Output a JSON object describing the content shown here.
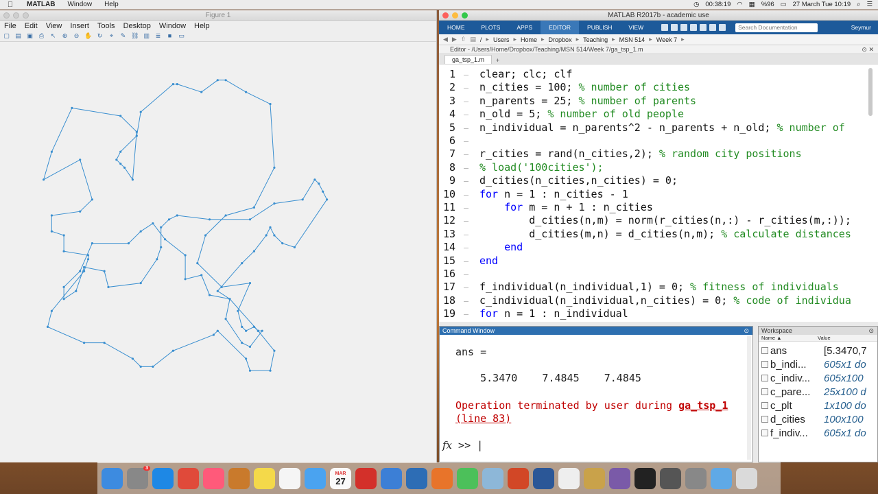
{
  "menubar": {
    "app": "MATLAB",
    "items": [
      "Window",
      "Help"
    ],
    "clock": "00:38:19",
    "battery": "%96",
    "date": "27 March Tue  10:19"
  },
  "figure": {
    "title": "Figure 1",
    "menu": [
      "File",
      "Edit",
      "View",
      "Insert",
      "Tools",
      "Desktop",
      "Window",
      "Help"
    ]
  },
  "matlab": {
    "title": "MATLAB R2017b - academic use",
    "tabs": [
      "HOME",
      "PLOTS",
      "APPS",
      "EDITOR",
      "PUBLISH",
      "VIEW"
    ],
    "active_tab": "EDITOR",
    "search_placeholder": "Search Documentation",
    "user": "Seymur",
    "path": [
      "/",
      "Users",
      "Home",
      "Dropbox",
      "Teaching",
      "MSN 514",
      "Week 7"
    ],
    "editor_header": "Editor - /Users/Home/Dropbox/Teaching/MSN 514/Week 7/ga_tsp_1.m",
    "file_tab": "ga_tsp_1.m"
  },
  "code": {
    "line_numbers": [
      "1",
      "2",
      "3",
      "4",
      "5",
      "6",
      "7",
      "8",
      "9",
      "10",
      "11",
      "12",
      "13",
      "14",
      "15",
      "16",
      "17",
      "18",
      "19"
    ],
    "lines": [
      {
        "pre": "clear; clc; clf",
        "comment": ""
      },
      {
        "pre": "n_cities = 100; ",
        "comment": "% number of cities"
      },
      {
        "pre": "n_parents = 25; ",
        "comment": "% number of parents"
      },
      {
        "pre": "n_old = 5; ",
        "comment": "% number of old people"
      },
      {
        "pre": "n_individual = n_parents^2 - n_parents + n_old; ",
        "comment": "% number of"
      },
      {
        "pre": "",
        "comment": ""
      },
      {
        "pre": "r_cities = rand(n_cities,2); ",
        "comment": "% random city positions"
      },
      {
        "pre": "",
        "comment": "% load('100cities');"
      },
      {
        "pre": "d_cities(n_cities,n_cities) = 0;",
        "comment": ""
      },
      {
        "kw": "for",
        "pre": " n = 1 : n_cities - 1",
        "comment": ""
      },
      {
        "indent": "    ",
        "kw": "for",
        "pre": " m = n + 1 : n_cities",
        "comment": ""
      },
      {
        "pre": "        d_cities(n,m) = norm(r_cities(n,:) - r_cities(m,:));",
        "comment": ""
      },
      {
        "pre": "        d_cities(m,n) = d_cities(n,m); ",
        "comment": "% calculate distances"
      },
      {
        "indent": "    ",
        "kw": "end",
        "pre": "",
        "comment": ""
      },
      {
        "kw": "end",
        "pre": "",
        "comment": ""
      },
      {
        "pre": "",
        "comment": ""
      },
      {
        "pre": "f_individual(n_individual,1) = 0; ",
        "comment": "% fitness of individuals"
      },
      {
        "pre": "c_individual(n_individual,n_cities) = 0; ",
        "comment": "% code of individua"
      },
      {
        "kw": "for",
        "pre": " n = 1 : n_individual",
        "comment": ""
      }
    ]
  },
  "command_window": {
    "title": "Command Window",
    "output_label": "ans =",
    "output_values": "    5.3470    7.4845    7.4845",
    "error_prefix": "Operation terminated by user during ",
    "error_func": "ga_tsp_1",
    "error_line": "(line 83)",
    "prompt": ">>",
    "fx": "fx"
  },
  "workspace": {
    "title": "Workspace",
    "col_name": "Name ▲",
    "col_value": "Value",
    "rows": [
      {
        "name": "ans",
        "value": "[5.3470,7"
      },
      {
        "name": "b_indi...",
        "value": "605x1 do"
      },
      {
        "name": "c_indiv...",
        "value": "605x100"
      },
      {
        "name": "c_pare...",
        "value": "25x100 d"
      },
      {
        "name": "c_plt",
        "value": "1x100 do"
      },
      {
        "name": "d_cities",
        "value": "100x100"
      },
      {
        "name": "f_indiv...",
        "value": "605x1 do"
      }
    ]
  },
  "dock": {
    "badge": "3",
    "calendar_month": "MAR",
    "calendar_day": "27",
    "items": [
      "finder-icon",
      "launchpad-icon",
      "safari-icon",
      "chrome-icon",
      "itunes-icon",
      "books-icon",
      "notes-icon",
      "reminders-icon",
      "messages-icon",
      "calendar-icon",
      "opera-icon",
      "keynote-icon",
      "quicktime-icon",
      "matlab-icon",
      "facetime-icon",
      "preview-icon",
      "powerpoint-icon",
      "word-icon",
      "textedit-icon",
      "archive-icon",
      "network-icon",
      "terminal-icon",
      "texmaker-icon",
      "system-prefs-icon",
      "folder-icon",
      "trash-icon"
    ]
  },
  "chart_data": {
    "type": "line",
    "color": "#3a8fd0",
    "xlim": [
      0,
      1
    ],
    "ylim": [
      0,
      1
    ],
    "points": [
      [
        0.49,
        0.94
      ],
      [
        0.47,
        0.94
      ],
      [
        0.43,
        0.91
      ],
      [
        0.37,
        0.93
      ],
      [
        0.36,
        0.93
      ],
      [
        0.28,
        0.86
      ],
      [
        0.27,
        0.8
      ],
      [
        0.23,
        0.76
      ],
      [
        0.22,
        0.74
      ],
      [
        0.23,
        0.73
      ],
      [
        0.24,
        0.72
      ],
      [
        0.26,
        0.69
      ],
      [
        0.27,
        0.81
      ],
      [
        0.23,
        0.85
      ],
      [
        0.11,
        0.87
      ],
      [
        0.06,
        0.76
      ],
      [
        0.04,
        0.69
      ],
      [
        0.13,
        0.74
      ],
      [
        0.16,
        0.64
      ],
      [
        0.13,
        0.61
      ],
      [
        0.06,
        0.6
      ],
      [
        0.06,
        0.56
      ],
      [
        0.09,
        0.55
      ],
      [
        0.09,
        0.51
      ],
      [
        0.15,
        0.5
      ],
      [
        0.15,
        0.49
      ],
      [
        0.14,
        0.46
      ],
      [
        0.06,
        0.36
      ],
      [
        0.05,
        0.32
      ],
      [
        0.14,
        0.28
      ],
      [
        0.19,
        0.28
      ],
      [
        0.26,
        0.24
      ],
      [
        0.28,
        0.22
      ],
      [
        0.31,
        0.22
      ],
      [
        0.36,
        0.26
      ],
      [
        0.46,
        0.3
      ],
      [
        0.47,
        0.31
      ],
      [
        0.54,
        0.24
      ],
      [
        0.55,
        0.21
      ],
      [
        0.6,
        0.21
      ],
      [
        0.61,
        0.26
      ],
      [
        0.57,
        0.31
      ],
      [
        0.5,
        0.39
      ],
      [
        0.47,
        0.41
      ],
      [
        0.53,
        0.48
      ],
      [
        0.56,
        0.51
      ],
      [
        0.59,
        0.55
      ],
      [
        0.6,
        0.57
      ],
      [
        0.61,
        0.55
      ],
      [
        0.63,
        0.53
      ],
      [
        0.66,
        0.52
      ],
      [
        0.74,
        0.64
      ],
      [
        0.73,
        0.66
      ],
      [
        0.72,
        0.68
      ],
      [
        0.71,
        0.69
      ],
      [
        0.68,
        0.64
      ],
      [
        0.61,
        0.63
      ],
      [
        0.55,
        0.59
      ],
      [
        0.45,
        0.59
      ],
      [
        0.37,
        0.6
      ],
      [
        0.35,
        0.59
      ],
      [
        0.33,
        0.57
      ],
      [
        0.33,
        0.52
      ],
      [
        0.32,
        0.49
      ],
      [
        0.28,
        0.43
      ],
      [
        0.2,
        0.42
      ],
      [
        0.19,
        0.46
      ],
      [
        0.14,
        0.47
      ],
      [
        0.12,
        0.41
      ],
      [
        0.09,
        0.39
      ],
      [
        0.09,
        0.42
      ],
      [
        0.13,
        0.46
      ],
      [
        0.16,
        0.53
      ],
      [
        0.25,
        0.53
      ],
      [
        0.28,
        0.56
      ],
      [
        0.31,
        0.58
      ],
      [
        0.34,
        0.54
      ],
      [
        0.39,
        0.5
      ],
      [
        0.39,
        0.44
      ],
      [
        0.43,
        0.45
      ],
      [
        0.45,
        0.4
      ],
      [
        0.5,
        0.39
      ],
      [
        0.49,
        0.34
      ],
      [
        0.53,
        0.28
      ],
      [
        0.55,
        0.27
      ],
      [
        0.58,
        0.31
      ],
      [
        0.57,
        0.31
      ],
      [
        0.56,
        0.32
      ],
      [
        0.54,
        0.31
      ],
      [
        0.53,
        0.32
      ],
      [
        0.52,
        0.36
      ],
      [
        0.55,
        0.43
      ],
      [
        0.48,
        0.42
      ],
      [
        0.42,
        0.48
      ],
      [
        0.44,
        0.55
      ],
      [
        0.49,
        0.6
      ],
      [
        0.56,
        0.62
      ],
      [
        0.61,
        0.72
      ],
      [
        0.6,
        0.88
      ],
      [
        0.54,
        0.91
      ]
    ]
  }
}
